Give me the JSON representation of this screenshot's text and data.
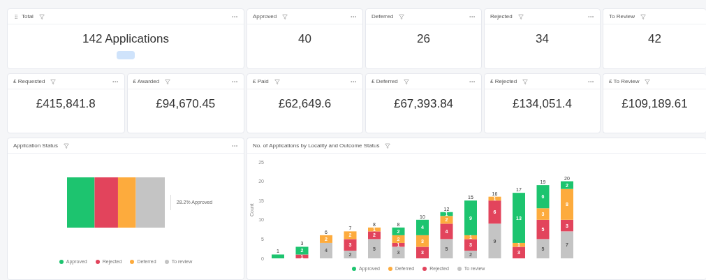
{
  "kpi_row_1": [
    {
      "title": "Total",
      "handle": true,
      "value": "142 Applications",
      "badge": true
    },
    {
      "title": "Approved",
      "value": "40"
    },
    {
      "title": "Deferred",
      "value": "26"
    },
    {
      "title": "Rejected",
      "value": "34"
    },
    {
      "title": "To Review",
      "value": "42"
    }
  ],
  "kpi_row_2": [
    {
      "title": "£ Requested",
      "value": "£415,841.8"
    },
    {
      "title": "£ Awarded",
      "value": "£94,670.45"
    },
    {
      "title": "£ Paid",
      "value": "£62,649.6"
    },
    {
      "title": "£ Deferred",
      "value": "£67,393.84"
    },
    {
      "title": "£ Rejected",
      "value": "£134,051.4"
    },
    {
      "title": "£ To Review",
      "value": "£109,189.61"
    }
  ],
  "status_panel": {
    "title": "Application Status",
    "annotation": "28.2% Approved",
    "legend": [
      {
        "name": "Approved",
        "color": "#1dc46f"
      },
      {
        "name": "Rejected",
        "color": "#e2445c"
      },
      {
        "name": "Deferred",
        "color": "#fdab3d"
      },
      {
        "name": "To review",
        "color": "#c4c4c4"
      }
    ]
  },
  "locality_panel": {
    "title": "No. of Applications by Locality and Outcome Status",
    "chart_data": {
      "type": "bar",
      "stacked": true,
      "ylabel": "Count",
      "ylim": [
        0,
        25
      ],
      "yticks": [
        0,
        5,
        10,
        15,
        20,
        25
      ],
      "legend": true,
      "series": [
        {
          "name": "Approved",
          "color": "#1dc46f",
          "values": [
            1,
            2,
            0,
            0,
            0,
            2,
            4,
            1,
            9,
            0,
            13,
            6,
            2
          ],
          "value_labels": [
            null,
            "2",
            null,
            null,
            null,
            "2",
            "4",
            "1",
            "9",
            null,
            "13",
            "6",
            "2"
          ]
        },
        {
          "name": "Deferred",
          "color": "#fdab3d",
          "values": [
            0,
            0,
            2,
            2,
            1,
            2,
            3,
            2,
            1,
            1,
            1,
            3,
            8
          ],
          "value_labels": [
            null,
            null,
            "2",
            "2",
            "1",
            "2",
            "3",
            "2",
            "1",
            "1",
            "1",
            "3",
            "8"
          ]
        },
        {
          "name": "Rejected",
          "color": "#e2445c",
          "values": [
            0,
            1,
            0,
            3,
            2,
            1,
            3,
            4,
            3,
            6,
            3,
            5,
            3
          ],
          "value_labels": [
            null,
            "1",
            null,
            "3",
            "2",
            "1",
            "3",
            "4",
            "3",
            "6",
            "3",
            "5",
            "3"
          ]
        },
        {
          "name": "To review",
          "color": "#c4c4c4",
          "values": [
            0,
            0,
            4,
            2,
            5,
            3,
            0,
            5,
            2,
            9,
            0,
            5,
            7
          ],
          "value_labels": [
            null,
            null,
            "4",
            "2",
            "5",
            "3",
            null,
            "5",
            "2",
            "9",
            null,
            "5",
            "7"
          ]
        }
      ],
      "annotations": [
        "1",
        "3",
        "6",
        "7",
        "8",
        "8",
        "10",
        "12",
        "15",
        "16",
        "17",
        "19",
        "20"
      ]
    }
  }
}
